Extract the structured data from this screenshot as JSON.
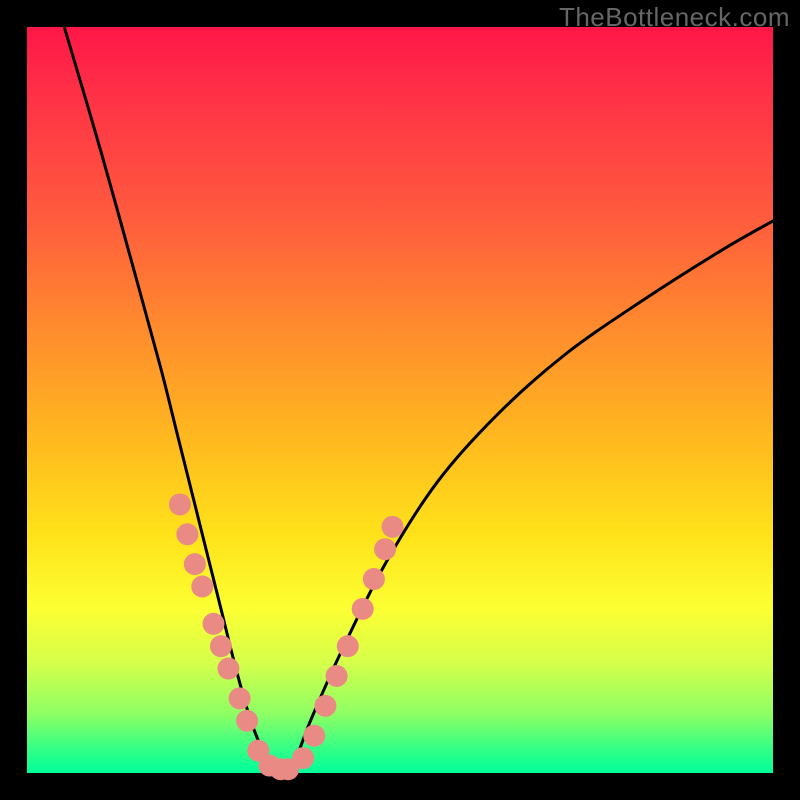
{
  "watermark": "TheBottleneck.com",
  "chart_data": {
    "type": "line",
    "title": "",
    "xlabel": "",
    "ylabel": "",
    "xlim": [
      0,
      100
    ],
    "ylim": [
      0,
      100
    ],
    "series": [
      {
        "name": "bottleneck-curve",
        "x": [
          5,
          10,
          15,
          18,
          20,
          22,
          24,
          26,
          28,
          30,
          32,
          33,
          34,
          36,
          38,
          42,
          48,
          55,
          63,
          72,
          82,
          93,
          100
        ],
        "values": [
          100,
          83,
          65,
          54,
          46,
          38,
          30,
          22,
          14,
          7,
          2,
          0,
          0,
          2,
          7,
          16,
          28,
          39,
          48,
          56,
          63,
          70,
          74
        ]
      }
    ],
    "markers": {
      "name": "highlight-dots",
      "color": "#e98a85",
      "points": [
        {
          "x": 20.5,
          "y": 36
        },
        {
          "x": 21.5,
          "y": 32
        },
        {
          "x": 22.5,
          "y": 28
        },
        {
          "x": 23.5,
          "y": 25
        },
        {
          "x": 25.0,
          "y": 20
        },
        {
          "x": 26.0,
          "y": 17
        },
        {
          "x": 27.0,
          "y": 14
        },
        {
          "x": 28.5,
          "y": 10
        },
        {
          "x": 29.5,
          "y": 7
        },
        {
          "x": 31.0,
          "y": 3
        },
        {
          "x": 32.5,
          "y": 1
        },
        {
          "x": 34.0,
          "y": 0.5
        },
        {
          "x": 35.0,
          "y": 0.5
        },
        {
          "x": 37.0,
          "y": 2
        },
        {
          "x": 38.5,
          "y": 5
        },
        {
          "x": 40.0,
          "y": 9
        },
        {
          "x": 41.5,
          "y": 13
        },
        {
          "x": 43.0,
          "y": 17
        },
        {
          "x": 45.0,
          "y": 22
        },
        {
          "x": 46.5,
          "y": 26
        },
        {
          "x": 48.0,
          "y": 30
        },
        {
          "x": 49.0,
          "y": 33
        }
      ]
    }
  }
}
